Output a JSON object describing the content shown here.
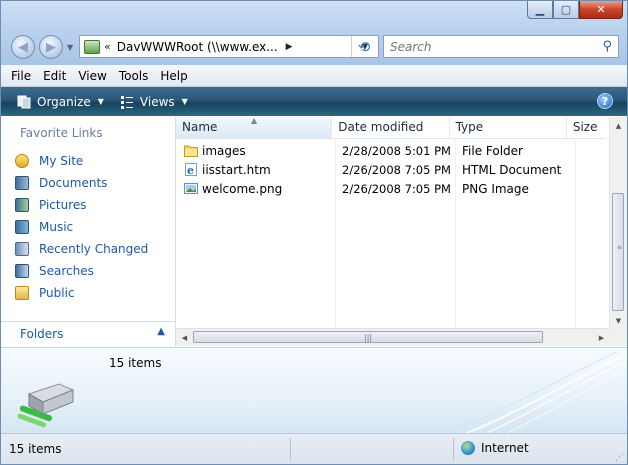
{
  "window": {
    "caption_buttons": {
      "minimize": "▁",
      "maximize": "▢",
      "close": "✕"
    }
  },
  "address": {
    "chevron": "«",
    "path": "DavWWWRoot (\\\\www.ex...",
    "arrow": "▶"
  },
  "search": {
    "placeholder": "Search"
  },
  "menu": [
    "File",
    "Edit",
    "View",
    "Tools",
    "Help"
  ],
  "toolbar": {
    "organize": "Organize",
    "views": "Views",
    "help": "?"
  },
  "favorites": {
    "title": "Favorite Links",
    "items": [
      {
        "label": "My Site",
        "icon": "my-site-icon"
      },
      {
        "label": "Documents",
        "icon": "documents-icon"
      },
      {
        "label": "Pictures",
        "icon": "pictures-icon"
      },
      {
        "label": "Music",
        "icon": "music-icon"
      },
      {
        "label": "Recently Changed",
        "icon": "recently-changed-icon"
      },
      {
        "label": "Searches",
        "icon": "searches-icon"
      },
      {
        "label": "Public",
        "icon": "public-folder-icon"
      }
    ],
    "folders_label": "Folders"
  },
  "columns": {
    "name": "Name",
    "date": "Date modified",
    "type": "Type",
    "size": "Size"
  },
  "files": [
    {
      "name": "images",
      "date": "2/28/2008 5:01 PM",
      "type": "File Folder",
      "icon": "folder-icon"
    },
    {
      "name": "iisstart.htm",
      "date": "2/26/2008 7:05 PM",
      "type": "HTML Document",
      "icon": "ie-document-icon"
    },
    {
      "name": "welcome.png",
      "date": "2/26/2008 7:05 PM",
      "type": "PNG Image",
      "icon": "image-file-icon"
    }
  ],
  "details": {
    "item_count": "15 items"
  },
  "status": {
    "left": "15 items",
    "zone": "Internet"
  },
  "colors": {
    "link": "#1a5aa8",
    "toolbar": "#2a5679",
    "title_gradient": "#bcd3ee"
  }
}
